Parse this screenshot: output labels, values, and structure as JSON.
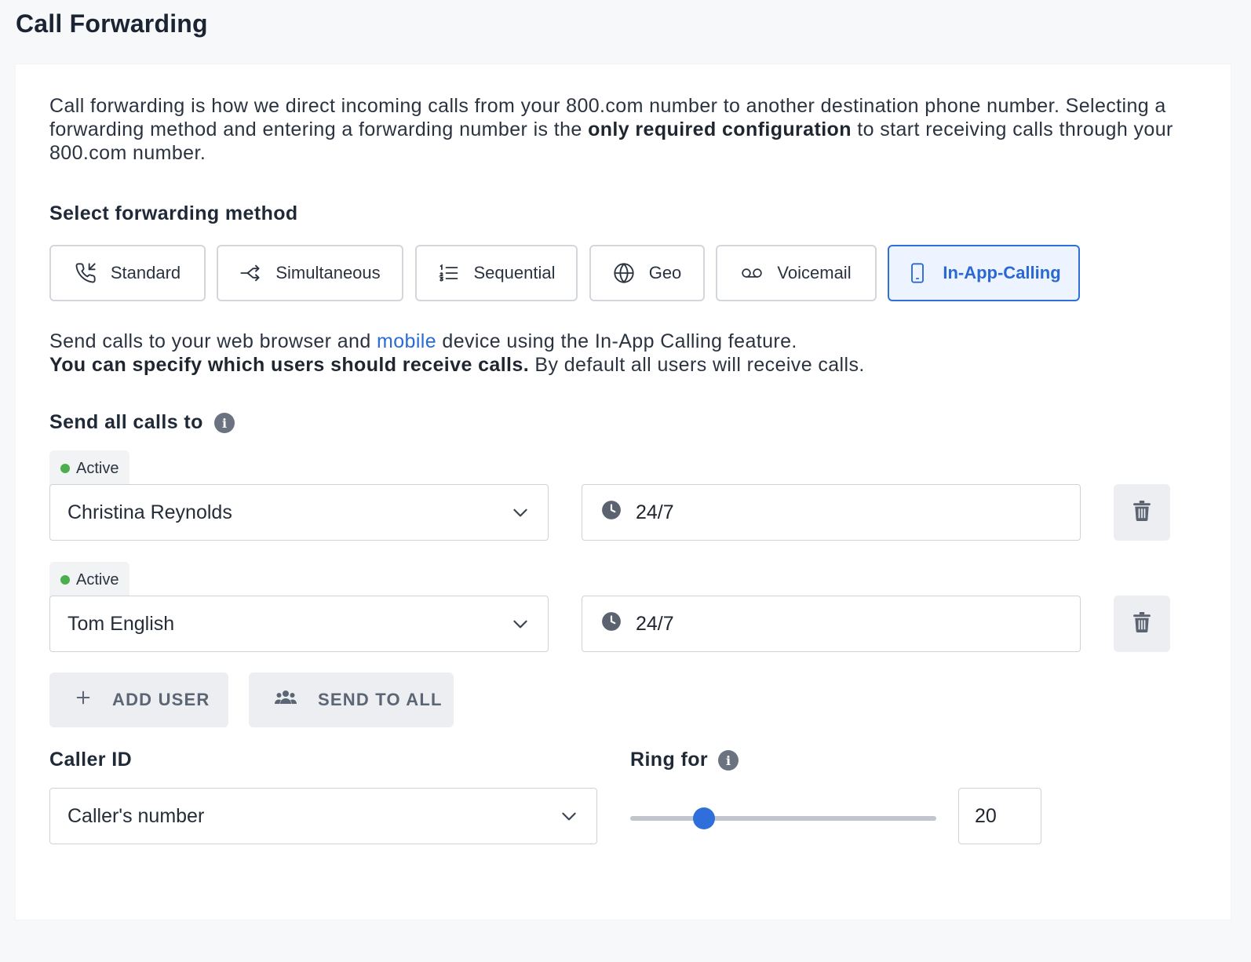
{
  "page": {
    "title": "Call Forwarding"
  },
  "intro": {
    "text_before": "Call forwarding is how we direct incoming calls from your 800.com number to another destination phone number. Selecting a forwarding method and entering a forwarding number is the ",
    "bold": "only required configuration",
    "text_after": " to start receiving calls through your 800.com number."
  },
  "methods": {
    "label": "Select forwarding method",
    "selected": "In-App-Calling",
    "items": [
      {
        "label": "Standard",
        "icon": "phone-incoming-icon"
      },
      {
        "label": "Simultaneous",
        "icon": "split-arrow-icon"
      },
      {
        "label": "Sequential",
        "icon": "numbered-list-icon"
      },
      {
        "label": "Geo",
        "icon": "globe-icon"
      },
      {
        "label": "Voicemail",
        "icon": "voicemail-icon"
      },
      {
        "label": "In-App-Calling",
        "icon": "mobile-phone-icon"
      }
    ]
  },
  "description": {
    "line1_before": "Send calls to your web browser and ",
    "line1_link": "mobile",
    "line1_after": " device using the In-App Calling feature.",
    "line2_bold": "You can specify which users should receive calls.",
    "line2_after": " By default all users will receive calls."
  },
  "send_to": {
    "label": "Send all calls to",
    "users": [
      {
        "status": "Active",
        "name": "Christina Reynolds",
        "schedule": "24/7"
      },
      {
        "status": "Active",
        "name": "Tom English",
        "schedule": "24/7"
      }
    ],
    "add_user_label": "ADD USER",
    "send_to_all_label": "SEND TO ALL"
  },
  "caller_id": {
    "label": "Caller ID",
    "value": "Caller's number"
  },
  "ring_for": {
    "label": "Ring for",
    "value": "20",
    "slider_fraction": 0.24
  },
  "colors": {
    "accent": "#2f6fdb",
    "active_dot": "#4cae4f"
  }
}
